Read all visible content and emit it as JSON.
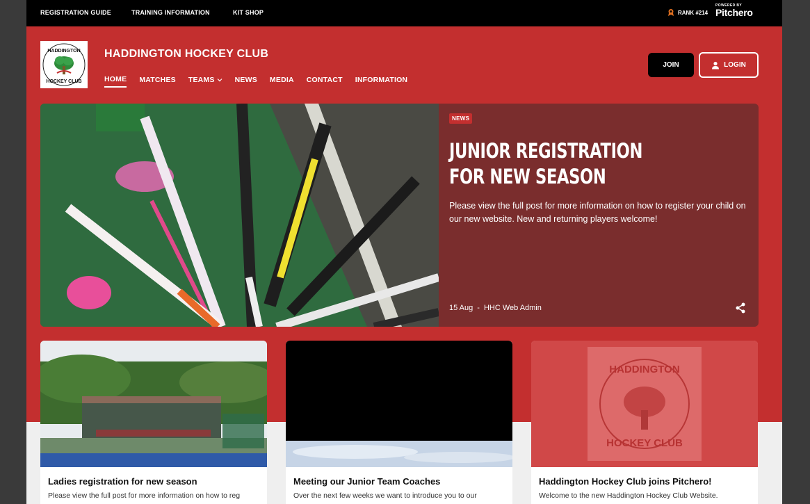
{
  "topbar": {
    "links": [
      "REGISTRATION GUIDE",
      "TRAINING INFORMATION",
      "KIT SHOP"
    ],
    "rank": "RANK #214",
    "powered_by": "POWERED BY",
    "brand": "Pitchero"
  },
  "header": {
    "club_name": "HADDINGTON HOCKEY CLUB",
    "nav": [
      "HOME",
      "MATCHES",
      "TEAMS",
      "NEWS",
      "MEDIA",
      "CONTACT",
      "INFORMATION"
    ],
    "active_nav": "HOME",
    "join_label": "JOIN",
    "login_label": "LOGIN"
  },
  "hero": {
    "badge": "NEWS",
    "title": "JUNIOR REGISTRATION FOR NEW SEASON",
    "description": "Please view the full post for more information on how to register your child on our new website. New and returning players welcome!",
    "date": "15 Aug",
    "separator": "-",
    "author": "HHC Web Admin"
  },
  "cards": [
    {
      "title": "Ladies registration for new season",
      "snippet": "Please view the full post for more information on how to reg"
    },
    {
      "title": "Meeting our Junior Team Coaches",
      "snippet": "Over the next few weeks we want to introduce you to our"
    },
    {
      "title": "Haddington Hockey Club joins Pitchero!",
      "snippet": "Welcome to the new Haddington Hockey Club Website."
    }
  ],
  "icons": {
    "rank": "rank-icon",
    "user": "user-icon",
    "share": "share-icon",
    "chevron": "chevron-down-icon"
  },
  "colors": {
    "brand_red": "#c32f2f",
    "hero_panel": "#7a2d2d",
    "topbar": "#000000"
  },
  "logo_text": {
    "top": "HADDINGTON",
    "bottom": "HOCKEY CLUB"
  }
}
